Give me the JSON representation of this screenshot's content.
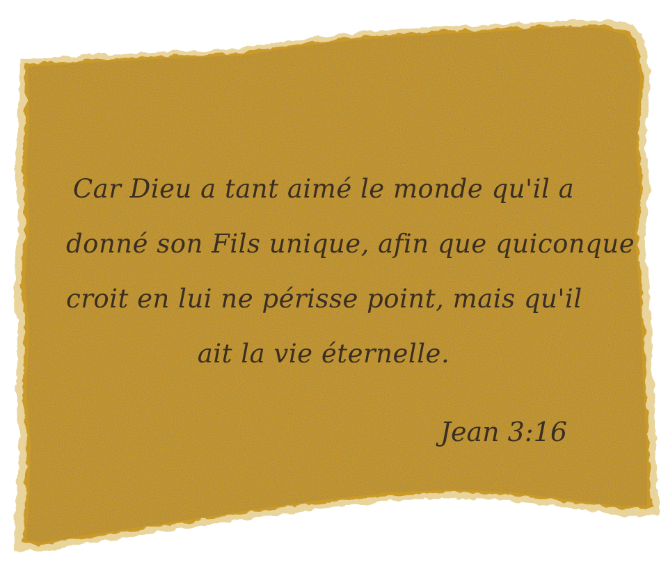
{
  "card": {
    "paper_color": "#c99a2a",
    "edge_color": "#e8cf93",
    "text_color": "#3a2e22",
    "verse_lines": [
      "Car Dieu a tant aimé le monde qu'il a",
      "donné son Fils unique, afin que quiconque",
      "croit en lui ne périsse point, mais qu'il",
      "ait la vie éternelle."
    ],
    "reference": "Jean 3:16"
  }
}
